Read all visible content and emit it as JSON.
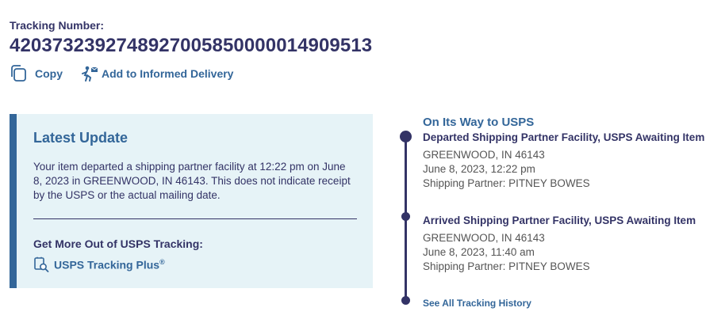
{
  "tracking": {
    "label": "Tracking Number:",
    "number": "420373239274892700585000001490951 3",
    "copy_label": "Copy",
    "informed_label": "Add to Informed Delivery"
  },
  "latest": {
    "title": "Latest Update",
    "text": "Your item departed a shipping partner facility at 12:22 pm on June 8, 2023 in GREENWOOD, IN 46143. This does not indicate receipt by the USPS or the actual mailing date.",
    "more_label": "Get More Out of USPS Tracking:",
    "plus_label": "USPS Tracking Plus",
    "plus_mark": "®"
  },
  "timeline": {
    "status": "On Its Way to USPS",
    "events": [
      {
        "title": "Departed Shipping Partner Facility, USPS Awaiting Item",
        "location": "GREENWOOD, IN 46143",
        "datetime": "June 8, 2023, 12:22 pm",
        "partner": "Shipping Partner: PITNEY BOWES"
      },
      {
        "title": "Arrived Shipping Partner Facility, USPS Awaiting Item",
        "location": "GREENWOOD, IN 46143",
        "datetime": "June 8, 2023, 11:40 am",
        "partner": "Shipping Partner: PITNEY BOWES"
      }
    ],
    "history_link": "See All Tracking History"
  },
  "colors": {
    "navy": "#333366",
    "link_blue": "#336699",
    "panel_bg": "#e6f3f7"
  },
  "icons": {
    "copy": "copy-icon",
    "informed": "informed-delivery-icon",
    "plus": "tracking-plus-icon"
  }
}
